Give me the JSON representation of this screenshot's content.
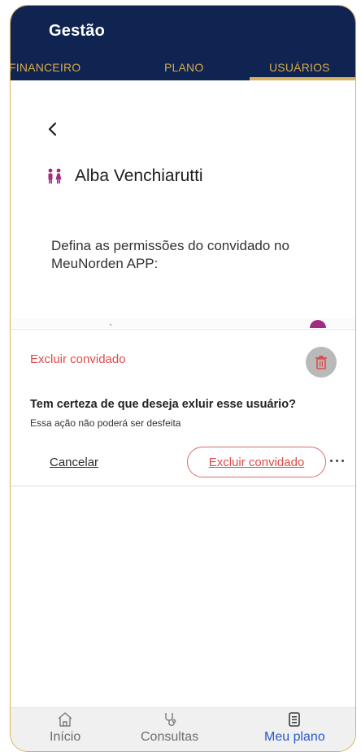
{
  "header": {
    "title": "Gestão",
    "tabs": [
      {
        "label": "FINANCEIRO"
      },
      {
        "label": "PLANO"
      },
      {
        "label": "USUÁRIOS",
        "active": true
      }
    ],
    "background_color": "#0f2451",
    "accent_color": "#d9b15a"
  },
  "page": {
    "back_icon": "chevron-left-icon",
    "user_icon": "people-icon",
    "user_name": "Alba Venchiarutti",
    "permissions_text": "Defina as permissões do convidado no MeuNorden APP:"
  },
  "dialog": {
    "title": "Excluir convidado",
    "delete_icon": "trash-icon",
    "question": "Tem certeza de que deseja exluir esse usuário?",
    "note": "Essa ação não poderá ser desfeita",
    "cancel_label": "Cancelar",
    "confirm_label": "Excluir convidado",
    "more_icon": "more-horizontal-icon",
    "danger_color": "#e04a4a"
  },
  "bottom_nav": {
    "items": [
      {
        "label": "Início",
        "icon": "home-icon"
      },
      {
        "label": "Consultas",
        "icon": "stethoscope-icon"
      },
      {
        "label": "Meu plano",
        "icon": "document-icon",
        "active": true
      }
    ],
    "active_color": "#2a57c9"
  }
}
